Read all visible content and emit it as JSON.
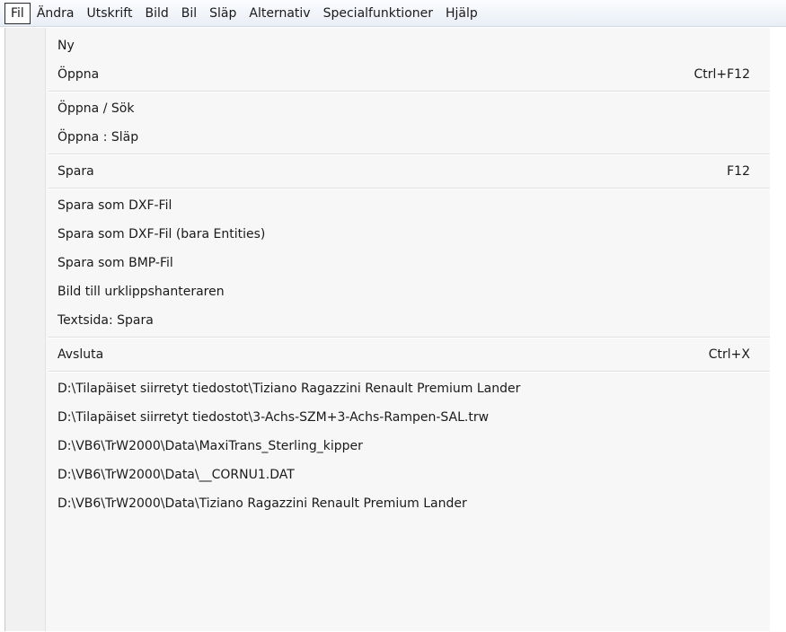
{
  "menubar": {
    "items": [
      {
        "label": "Fil"
      },
      {
        "label": "Ändra"
      },
      {
        "label": "Utskrift"
      },
      {
        "label": "Bild"
      },
      {
        "label": "Bil"
      },
      {
        "label": "Släp"
      },
      {
        "label": "Alternativ"
      },
      {
        "label": "Specialfunktioner"
      },
      {
        "label": "Hjälp"
      }
    ]
  },
  "menu": {
    "groups": [
      [
        {
          "label": "Ny",
          "shortcut": ""
        },
        {
          "label": "Öppna",
          "shortcut": "Ctrl+F12"
        }
      ],
      [
        {
          "label": "Öppna / Sök",
          "shortcut": ""
        },
        {
          "label": "Öppna :  Släp",
          "shortcut": ""
        }
      ],
      [
        {
          "label": "Spara",
          "shortcut": "F12"
        }
      ],
      [
        {
          "label": "Spara som DXF-Fil",
          "shortcut": ""
        },
        {
          "label": "Spara som DXF-Fil (bara Entities)",
          "shortcut": ""
        },
        {
          "label": "Spara som BMP-Fil",
          "shortcut": ""
        },
        {
          "label": "Bild till urklippshanteraren",
          "shortcut": ""
        },
        {
          "label": "Textsida: Spara",
          "shortcut": ""
        }
      ],
      [
        {
          "label": "Avsluta",
          "shortcut": "Ctrl+X"
        }
      ],
      [
        {
          "label": "D:\\Tilapäiset siirretyt tiedostot\\Tiziano Ragazzini Renault Premium Lander",
          "shortcut": ""
        },
        {
          "label": "D:\\Tilapäiset siirretyt tiedostot\\3-Achs-SZM+3-Achs-Rampen-SAL.trw",
          "shortcut": ""
        },
        {
          "label": "D:\\VB6\\TrW2000\\Data\\MaxiTrans_Sterling_kipper",
          "shortcut": ""
        },
        {
          "label": "D:\\VB6\\TrW2000\\Data\\__CORNU1.DAT",
          "shortcut": ""
        },
        {
          "label": "D:\\VB6\\TrW2000\\Data\\Tiziano Ragazzini Renault Premium Lander",
          "shortcut": ""
        }
      ]
    ]
  }
}
